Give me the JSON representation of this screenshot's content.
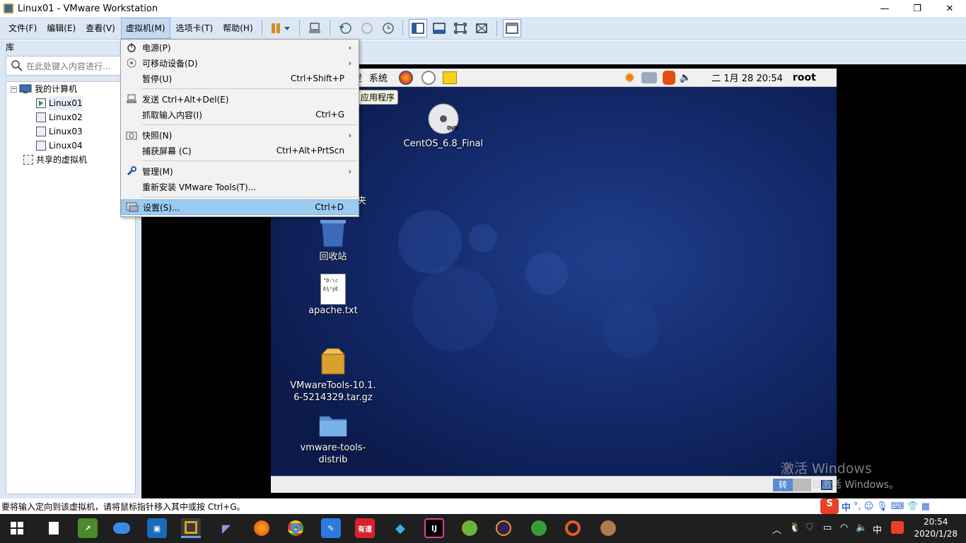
{
  "window": {
    "title": "Linux01 - VMware Workstation",
    "minimize": "—",
    "maximize": "❐",
    "close": "✕"
  },
  "menubar": {
    "items": [
      "文件(F)",
      "编辑(E)",
      "查看(V)",
      "虚拟机(M)",
      "选项卡(T)",
      "帮助(H)"
    ],
    "active_index": 3
  },
  "library": {
    "header": "库",
    "search_placeholder": "在此处键入内容进行...",
    "tree": {
      "root": "我的计算机",
      "vms": [
        "Linux01",
        "Linux02",
        "Linux03",
        "Linux04"
      ],
      "shared": "共享的虚拟机"
    }
  },
  "context_menu": {
    "items": [
      {
        "label": "电源(P)",
        "shortcut": "",
        "submenu": true,
        "icon": "power-icon"
      },
      {
        "label": "可移动设备(D)",
        "shortcut": "",
        "submenu": true,
        "icon": "removable-device-icon"
      },
      {
        "label": "暂停(U)",
        "shortcut": "Ctrl+Shift+P",
        "submenu": false,
        "icon": ""
      },
      {
        "label": "发送 Ctrl+Alt+Del(E)",
        "shortcut": "",
        "submenu": false,
        "icon": "send-keys-icon"
      },
      {
        "label": "抓取输入内容(I)",
        "shortcut": "Ctrl+G",
        "submenu": false,
        "icon": ""
      },
      {
        "label": "快照(N)",
        "shortcut": "",
        "submenu": true,
        "icon": "snapshot-icon"
      },
      {
        "label": "捕获屏幕 (C)",
        "shortcut": "Ctrl+Alt+PrtScn",
        "submenu": false,
        "icon": ""
      },
      {
        "label": "管理(M)",
        "shortcut": "",
        "submenu": true,
        "icon": "wrench-icon"
      },
      {
        "label": "重新安装 VMware Tools(T)...",
        "shortcut": "",
        "submenu": false,
        "icon": ""
      },
      {
        "label": "设置(S)...",
        "shortcut": "Ctrl+D",
        "submenu": false,
        "icon": "settings-icon",
        "highlighted": true
      }
    ]
  },
  "guest": {
    "panel": {
      "system_menu": "系统",
      "date": "二 1月 28 20:54",
      "user": "root",
      "menu_partial": "罡"
    },
    "tooltip": "应用程序",
    "desktop_icons": [
      {
        "label": "CentOS_6.8_Final",
        "icon": "dvd-icon"
      },
      {
        "label": "夹",
        "icon": "folder-icon"
      },
      {
        "label": "回收站",
        "icon": "trash-icon"
      },
      {
        "label": "apache.txt",
        "icon": "text-file-icon",
        "preview": "\"D:\\c\nÉ¾³ýÊ"
      },
      {
        "label": "VMwareTools-10.1.\n6-5214329.tar.gz",
        "icon": "archive-icon"
      },
      {
        "label": "vmware-tools-\ndistrib",
        "icon": "folder-icon"
      }
    ],
    "bottom_partial": "转"
  },
  "statusbar": {
    "text": "要将输入定向到该虚拟机，请将鼠标指针移入其中或按 Ctrl+G。"
  },
  "watermark": {
    "line1": "激活 Windows",
    "line2": "以激活 Windows。"
  },
  "ime": {
    "lang": "中",
    "punct": "°,"
  },
  "taskbar": {
    "time": "20:54",
    "date": "2020/1/28",
    "ime_lang": "中",
    "youdao": "有道",
    "ij": "IJ"
  },
  "colors": {
    "menubar_bg": "#dbe7f4",
    "highlight": "#9ccbf2",
    "guest_bg": "#13296a",
    "taskbar_bg": "#1f1f1f"
  }
}
